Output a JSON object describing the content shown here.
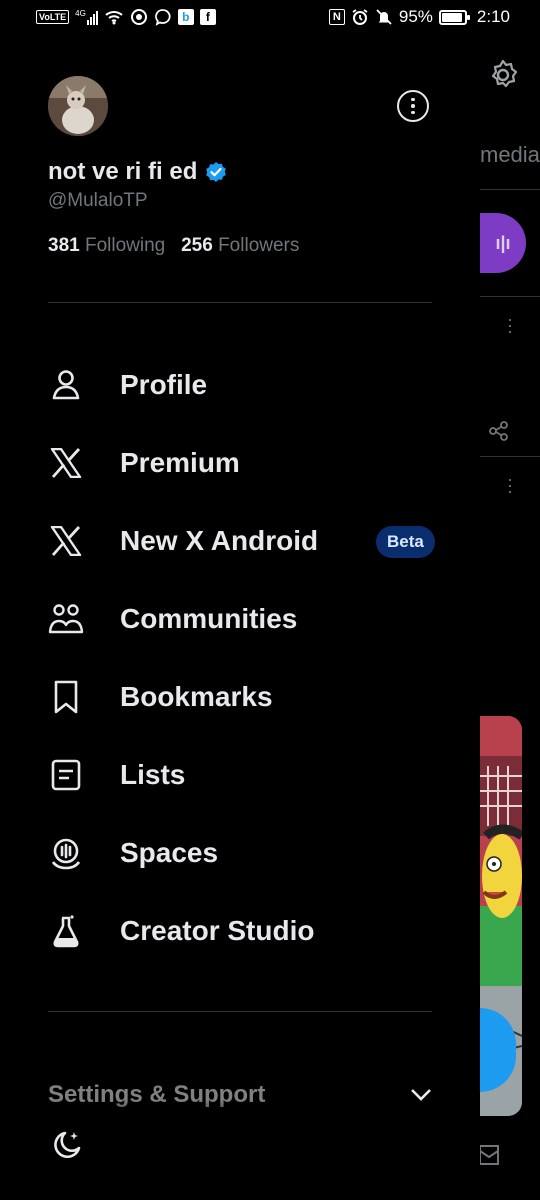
{
  "status_bar": {
    "volte": "VoLTE",
    "network": "4G",
    "bing_badge": "b",
    "fb_badge": "f",
    "nfc": "N",
    "battery": "95%",
    "time": "2:10"
  },
  "profile": {
    "display_name": "not ve ri fi ed",
    "handle": "@MulaloTP",
    "following_count": "381",
    "following_label": "Following",
    "followers_count": "256",
    "followers_label": "Followers"
  },
  "menu": {
    "items": [
      {
        "label": "Profile",
        "icon": "person-icon"
      },
      {
        "label": "Premium",
        "icon": "x-logo-icon"
      },
      {
        "label": "New X Android",
        "icon": "x-logo-icon",
        "badge": "Beta"
      },
      {
        "label": "Communities",
        "icon": "communities-icon"
      },
      {
        "label": "Bookmarks",
        "icon": "bookmark-icon"
      },
      {
        "label": "Lists",
        "icon": "list-icon"
      },
      {
        "label": "Spaces",
        "icon": "spaces-icon"
      },
      {
        "label": "Creator Studio",
        "icon": "creator-studio-icon"
      }
    ]
  },
  "settings_support": "Settings & Support",
  "background": {
    "tab_label": "media"
  },
  "colors": {
    "verified": "#1d9bf0",
    "beta_bg": "#0a2d6e",
    "pill": "#7e3cc4",
    "fab": "#1d9bf0"
  }
}
